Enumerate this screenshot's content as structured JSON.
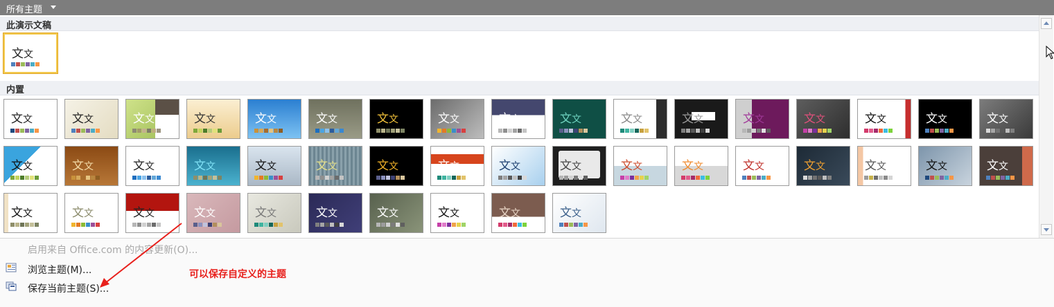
{
  "topbar": {
    "label": "所有主题"
  },
  "sections": {
    "current": "此演示文稿",
    "builtin": "内置"
  },
  "tile_text": {
    "big": "文",
    "small": "文"
  },
  "menu": {
    "update": "启用来自 Office.com 的内容更新(O)...",
    "browse": "浏览主题(M)...",
    "save": "保存当前主题(S)..."
  },
  "annotation": "可以保存自定义的主题",
  "colors": {
    "topbar": "#7d7d7d",
    "selected_border": "#f3c94d",
    "annotation": "#e8201c"
  }
}
